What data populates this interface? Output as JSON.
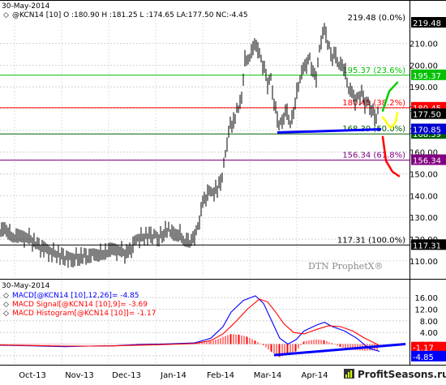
{
  "header": {
    "date": "30-May-2014",
    "symbol_line": "@KCN14 [10] O :180.90 H :181.25 L :174.65 LA:177.50 NC:-4.45"
  },
  "watermark": "DTN ProphetX®",
  "logo": "ProfitSeasons.ru",
  "colors": {
    "up": "#000000",
    "down": "#000000",
    "macd": "#0000ff",
    "signal": "#ff0000",
    "histogram": "#ff0000",
    "fib_236": "#00c000",
    "fib_382": "#ff0000",
    "fib_50": "#006000",
    "fib_618": "#800080",
    "trend": "#0000ff"
  },
  "chart_data": [
    {
      "type": "candlestick",
      "title": "@KCN14 [10]",
      "ylim": [
        104,
        221
      ],
      "yticks": [
        110,
        120,
        130,
        140,
        150,
        160,
        170,
        180,
        190,
        200,
        210
      ],
      "month_labels": [
        "Oct-13",
        "Nov-13",
        "Dec-13",
        "Jan-14",
        "Feb-14",
        "Mar-14",
        "Apr-14"
      ],
      "price_path": [
        [
          0,
          124
        ],
        [
          6,
          125
        ],
        [
          12,
          122
        ],
        [
          18,
          121
        ],
        [
          24,
          121
        ],
        [
          30,
          121
        ],
        [
          38,
          120
        ],
        [
          46,
          117
        ],
        [
          54,
          116
        ],
        [
          62,
          114
        ],
        [
          70,
          113
        ],
        [
          78,
          112
        ],
        [
          86,
          111
        ],
        [
          92,
          111
        ],
        [
          100,
          112
        ],
        [
          108,
          112
        ],
        [
          116,
          113
        ],
        [
          124,
          113
        ],
        [
          132,
          114
        ],
        [
          138,
          115
        ],
        [
          144,
          115
        ],
        [
          152,
          114
        ],
        [
          158,
          113
        ],
        [
          164,
          118
        ],
        [
          170,
          120
        ],
        [
          178,
          121
        ],
        [
          186,
          122
        ],
        [
          192,
          121
        ],
        [
          196,
          120
        ],
        [
          204,
          124
        ],
        [
          210,
          124
        ],
        [
          216,
          122
        ],
        [
          222,
          122
        ],
        [
          228,
          119
        ],
        [
          236,
          119
        ],
        [
          240,
          122
        ],
        [
          244,
          126
        ],
        [
          250,
          136
        ],
        [
          256,
          142
        ],
        [
          262,
          141
        ],
        [
          268,
          143
        ],
        [
          272,
          146
        ],
        [
          278,
          158
        ],
        [
          282,
          170
        ],
        [
          288,
          174
        ],
        [
          294,
          181
        ],
        [
          298,
          185
        ],
        [
          302,
          202
        ],
        [
          308,
          204
        ],
        [
          314,
          209
        ],
        [
          318,
          208
        ],
        [
          322,
          203
        ],
        [
          326,
          198
        ],
        [
          330,
          191
        ],
        [
          334,
          194
        ],
        [
          338,
          183
        ],
        [
          342,
          175
        ],
        [
          346,
          173
        ],
        [
          350,
          176
        ],
        [
          354,
          178
        ],
        [
          358,
          174
        ],
        [
          362,
          178
        ],
        [
          366,
          187
        ],
        [
          370,
          194
        ],
        [
          374,
          198
        ],
        [
          378,
          201
        ],
        [
          382,
          204
        ],
        [
          386,
          196
        ],
        [
          390,
          194
        ],
        [
          394,
          207
        ],
        [
          398,
          216
        ],
        [
          402,
          214
        ],
        [
          406,
          208
        ],
        [
          410,
          203
        ],
        [
          414,
          204
        ],
        [
          418,
          201
        ],
        [
          422,
          200
        ],
        [
          426,
          196
        ],
        [
          430,
          189
        ],
        [
          434,
          187
        ],
        [
          438,
          184
        ],
        [
          442,
          186
        ],
        [
          446,
          187
        ],
        [
          450,
          182
        ],
        [
          454,
          183
        ],
        [
          458,
          180
        ],
        [
          462,
          176
        ],
        [
          466,
          178
        ],
        [
          468,
          177.5
        ]
      ],
      "last_price": "177.50",
      "levels": [
        {
          "name": "high",
          "value": 219.48,
          "label": "219.48 (0.0%)",
          "tag": "219.48",
          "tag_color": "#000000"
        },
        {
          "name": "fib_236",
          "value": 195.37,
          "label": "195.37 (23.6%)",
          "tag": "195.37",
          "tag_color": "#00c000"
        },
        {
          "name": "fib_382",
          "value": 180.45,
          "label": "180.45 (38.2%)",
          "tag": "180.45",
          "tag_color": "#ff0000"
        },
        {
          "name": "fib_50",
          "value": 168.39,
          "label": "168.39 (50.0%)",
          "tag": "168.39",
          "tag_color": "#006000"
        },
        {
          "name": "fib_618",
          "value": 156.34,
          "label": "156.34 (61.8%)",
          "tag": "156.34",
          "tag_color": "#800080"
        },
        {
          "name": "low",
          "value": 117.31,
          "label": "117.31 (100.0%)",
          "tag": "117.31",
          "tag_color": "#000000"
        }
      ],
      "trendline": {
        "from": [
          342,
          169
        ],
        "to": [
          470,
          170.5
        ]
      },
      "trend_tag": "170.85",
      "projections": [
        {
          "color": "#00cc00",
          "points": [
            [
              472,
              179
            ],
            [
              480,
              188
            ],
            [
              490,
              192
            ]
          ]
        },
        {
          "color": "#ffff00",
          "points": [
            [
              472,
              176
            ],
            [
              482,
              171
            ],
            [
              488,
              174
            ],
            [
              490,
              178
            ]
          ]
        },
        {
          "color": "#ff0000",
          "points": [
            [
              472,
              167
            ],
            [
              476,
              156
            ],
            [
              484,
              151
            ],
            [
              492,
              149
            ]
          ]
        }
      ]
    },
    {
      "type": "line",
      "title": "MACD",
      "header_date": "30-May-2014",
      "ylim": [
        -6,
        18
      ],
      "yticks": [
        -4,
        0,
        4,
        8,
        12,
        16
      ],
      "series": [
        {
          "name": "MACD[@KCN14 [10],12,26]= -4.85",
          "tag": "-4.85",
          "color": "#0000ff",
          "points": [
            [
              0,
              -0.4
            ],
            [
              40,
              -0.6
            ],
            [
              80,
              -0.9
            ],
            [
              110,
              -0.7
            ],
            [
              140,
              -0.6
            ],
            [
              170,
              -0.2
            ],
            [
              200,
              0.0
            ],
            [
              240,
              0.4
            ],
            [
              260,
              2
            ],
            [
              275,
              6
            ],
            [
              285,
              11
            ],
            [
              300,
              15
            ],
            [
              315,
              16.6
            ],
            [
              325,
              14
            ],
            [
              335,
              8
            ],
            [
              345,
              2
            ],
            [
              355,
              0
            ],
            [
              365,
              1.5
            ],
            [
              375,
              4.5
            ],
            [
              390,
              6.5
            ],
            [
              400,
              7.5
            ],
            [
              410,
              6
            ],
            [
              425,
              4.5
            ],
            [
              440,
              2
            ],
            [
              455,
              -1.5
            ],
            [
              468,
              -2.5
            ]
          ]
        },
        {
          "name": "MACD Signal[@KCN14 [10],9]= -3.69",
          "tag": "",
          "color": "#ff0000",
          "points": [
            [
              0,
              -0.3
            ],
            [
              40,
              -0.5
            ],
            [
              80,
              -0.7
            ],
            [
              110,
              -0.7
            ],
            [
              140,
              -0.6
            ],
            [
              170,
              -0.4
            ],
            [
              200,
              -0.2
            ],
            [
              240,
              0.2
            ],
            [
              260,
              1.2
            ],
            [
              275,
              3.5
            ],
            [
              290,
              7.5
            ],
            [
              305,
              12
            ],
            [
              320,
              15.5
            ],
            [
              330,
              14.5
            ],
            [
              340,
              11
            ],
            [
              350,
              7
            ],
            [
              362,
              4
            ],
            [
              375,
              3.5
            ],
            [
              390,
              5
            ],
            [
              405,
              6.3
            ],
            [
              420,
              6
            ],
            [
              435,
              4.5
            ],
            [
              450,
              2
            ],
            [
              468,
              -0.5
            ]
          ]
        },
        {
          "name": "MACD Histogram[@KCN14 [10]]= -1.17",
          "tag": "-1.17",
          "color": "#ff0000",
          "points": [
            [
              0,
              -0.1
            ],
            [
              60,
              -0.2
            ],
            [
              120,
              0.0
            ],
            [
              180,
              0.2
            ],
            [
              240,
              0.3
            ],
            [
              260,
              0.9
            ],
            [
              275,
              2.5
            ],
            [
              285,
              3.5
            ],
            [
              295,
              3.2
            ],
            [
              305,
              2.5
            ],
            [
              315,
              1.1
            ],
            [
              325,
              -0.4
            ],
            [
              335,
              -2.8
            ],
            [
              345,
              -4.5
            ],
            [
              355,
              -3.5
            ],
            [
              365,
              -2.5
            ],
            [
              375,
              1.0
            ],
            [
              390,
              1.6
            ],
            [
              400,
              1.3
            ],
            [
              410,
              0.2
            ],
            [
              420,
              -1.0
            ],
            [
              435,
              -2.0
            ],
            [
              450,
              -2.3
            ],
            [
              468,
              -2.0
            ]
          ]
        }
      ],
      "trendline": {
        "from": [
          338,
          -3.8
        ],
        "to": [
          500,
          0.0
        ]
      }
    }
  ]
}
